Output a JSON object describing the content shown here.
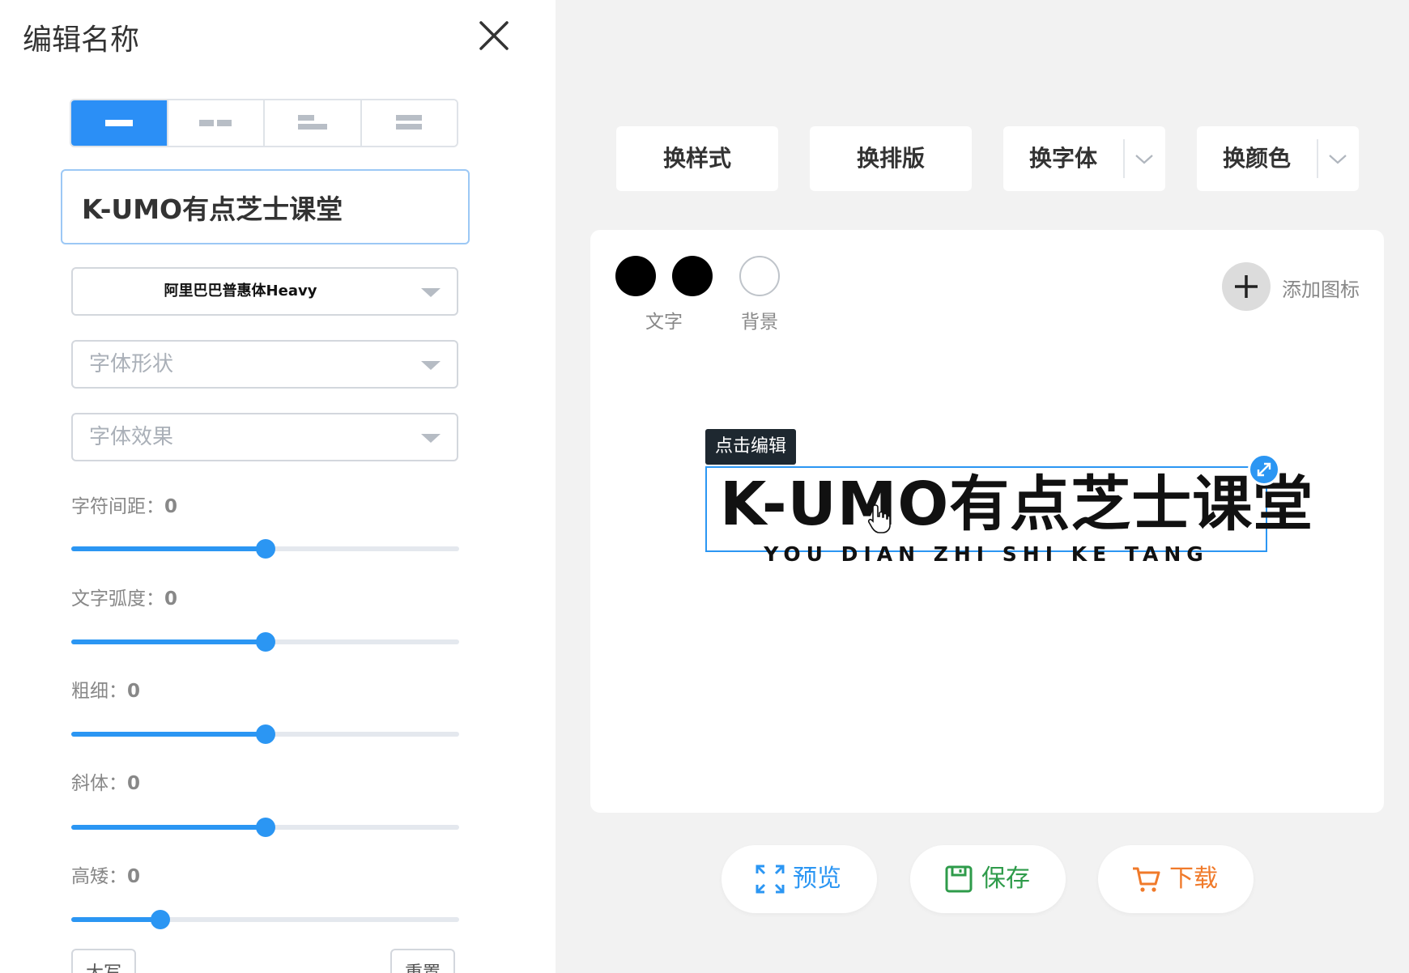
{
  "left_panel": {
    "title": "编辑名称",
    "name_value": "K-UMO有点芝士课堂",
    "font_select": "阿里巴巴普惠体Heavy",
    "shape_select_placeholder": "字体形状",
    "effect_select_placeholder": "字体效果",
    "sliders": [
      {
        "label": "字符间距：",
        "value": "0",
        "level": 0.5
      },
      {
        "label": "文字弧度：",
        "value": "0",
        "level": 0.5
      },
      {
        "label": "粗细：",
        "value": "0",
        "level": 0.5
      },
      {
        "label": "斜体：",
        "value": "0",
        "level": 0.5
      },
      {
        "label": "高矮：",
        "value": "0",
        "level": 0.23
      }
    ],
    "uppercase_button": "大写",
    "reset_button": "重置"
  },
  "toolbar": {
    "change_style": "换样式",
    "change_layout": "换排版",
    "change_font": "换字体",
    "change_color": "换颜色"
  },
  "canvas": {
    "text_color_label": "文字",
    "bg_color_label": "背景",
    "add_icon_label": "添加图标",
    "tooltip": "点击编辑",
    "logo_main": "K-UMO有点芝士课堂",
    "logo_sub": "YOU DIAN ZHI SHI KE TANG"
  },
  "actions": {
    "preview": "预览",
    "save": "保存",
    "download": "下载"
  },
  "colors": {
    "accent": "#2b96f3",
    "save_green": "#2e9b4a",
    "download_orange": "#f07a2a",
    "text_swatch_1": "#000000",
    "text_swatch_2": "#000000",
    "bg_swatch": "#ffffff"
  }
}
